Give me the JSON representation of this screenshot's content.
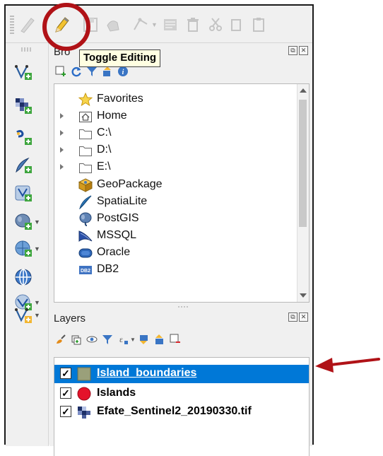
{
  "tooltip": {
    "text": "Toggle Editing"
  },
  "toolbar": {
    "icons": [
      "digitize-icon",
      "toggle-editing-pencil-icon",
      "save-layer-edits-icon",
      "add-feature-icon",
      "vertex-tool-icon",
      "modify-attributes-icon",
      "delete-selected-icon",
      "cut-features-icon",
      "copy-features-icon",
      "paste-features-icon"
    ]
  },
  "left_toolbar": {
    "icons": [
      "new-vector-layer-icon",
      "add-raster-layer-icon",
      "add-mesh-layer-icon",
      "add-delimited-text-icon",
      "add-geopackage-layer-icon",
      "add-postgis-layer-icon",
      "add-wms-layer-icon",
      "add-wfs-layer-icon",
      "add-vector-tile-icon",
      "new-layer-icon"
    ]
  },
  "browser_panel": {
    "title": "Bro",
    "toolbar_icons": [
      "add-selected-layers-icon",
      "refresh-icon",
      "filter-icon",
      "collapse-all-icon",
      "properties-icon"
    ],
    "items": [
      {
        "label": "Favorites",
        "icon": "star-icon",
        "expandable": false
      },
      {
        "label": "Home",
        "icon": "home-folder-icon",
        "expandable": true
      },
      {
        "label": "C:\\",
        "icon": "folder-icon",
        "expandable": true
      },
      {
        "label": "D:\\",
        "icon": "folder-icon",
        "expandable": true
      },
      {
        "label": "E:\\",
        "icon": "folder-icon",
        "expandable": true
      },
      {
        "label": "GeoPackage",
        "icon": "geopackage-icon",
        "expandable": false
      },
      {
        "label": "SpatiaLite",
        "icon": "spatialite-feather-icon",
        "expandable": false
      },
      {
        "label": "PostGIS",
        "icon": "postgis-elephant-icon",
        "expandable": false
      },
      {
        "label": "MSSQL",
        "icon": "mssql-icon",
        "expandable": false
      },
      {
        "label": "Oracle",
        "icon": "oracle-icon",
        "expandable": false
      },
      {
        "label": "DB2",
        "icon": "db2-icon",
        "expandable": false
      }
    ]
  },
  "layers_panel": {
    "title": "Layers",
    "toolbar_icons": [
      "style-icon",
      "add-group-icon",
      "manage-visibility-icon",
      "filter-legend-icon",
      "filter-by-expression-icon",
      "expand-all-icon",
      "collapse-all-icon",
      "remove-layer-icon"
    ],
    "layers": [
      {
        "name": "Island_boundaries",
        "checked": true,
        "selected": true,
        "symbol": "polygon-swatch",
        "color": "#9aa07a"
      },
      {
        "name": "Islands",
        "checked": true,
        "selected": false,
        "symbol": "point-circle",
        "color": "#e4132a"
      },
      {
        "name": "Efate_Sentinel2_20190330.tif",
        "checked": true,
        "selected": false,
        "symbol": "raster-icon",
        "color": "#1a3a7a"
      }
    ]
  },
  "colors": {
    "selection": "#0078d7",
    "annotation_red": "#b01217"
  }
}
